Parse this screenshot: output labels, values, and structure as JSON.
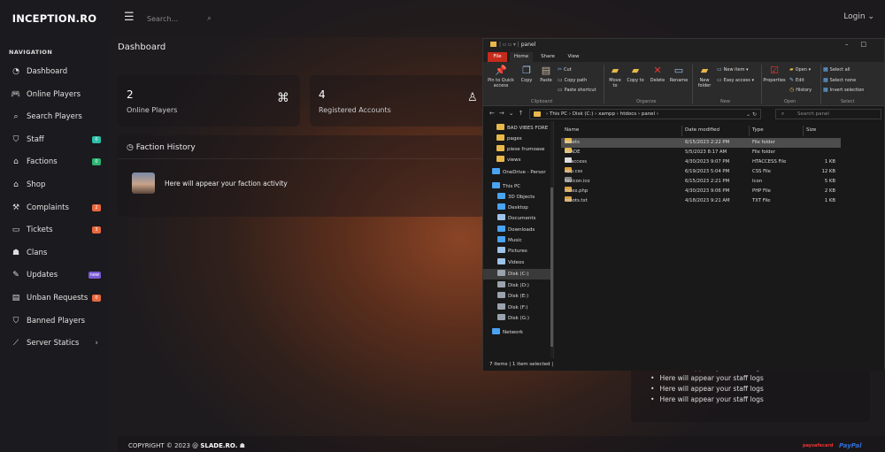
{
  "site": {
    "brand": "INCEPTION.RO",
    "login_label": "Login ⌄"
  },
  "search": {
    "placeholder": "Search..."
  },
  "sidebar": {
    "section_title": "NAVIGATION",
    "items": [
      {
        "label": "Dashboard",
        "icon": "dashboard-icon",
        "glyph": "◔"
      },
      {
        "label": "Online Players",
        "icon": "gamepad-icon",
        "glyph": "🎮"
      },
      {
        "label": "Search Players",
        "icon": "search-icon",
        "glyph": "⌕"
      },
      {
        "label": "Staff",
        "icon": "shield-icon",
        "glyph": "⛉",
        "badge": "0",
        "badge_color": "#2bbfa8"
      },
      {
        "label": "Factions",
        "icon": "bank-icon",
        "glyph": "⌂",
        "badge": "0",
        "badge_color": "#2bb673"
      },
      {
        "label": "Shop",
        "icon": "shop-icon",
        "glyph": "⌂"
      },
      {
        "label": "Complaints",
        "icon": "hammer-icon",
        "glyph": "⚒",
        "badge": "2",
        "badge_color": "#e9683e"
      },
      {
        "label": "Tickets",
        "icon": "ticket-icon",
        "glyph": "▭",
        "badge": "3",
        "badge_color": "#e9683e"
      },
      {
        "label": "Clans",
        "icon": "clans-icon",
        "glyph": "☗"
      },
      {
        "label": "Updates",
        "icon": "updates-icon",
        "glyph": "✎",
        "badge": "new",
        "badge_color": "#7a5ad6"
      },
      {
        "label": "Unban Requests",
        "icon": "document-icon",
        "glyph": "▤",
        "badge": "0",
        "badge_color": "#e9683e"
      },
      {
        "label": "Banned Players",
        "icon": "ban-shield-icon",
        "glyph": "⛉"
      },
      {
        "label": "Server Statics",
        "icon": "chart-icon",
        "glyph": "⟋",
        "chevron": "›"
      }
    ]
  },
  "dashboard": {
    "title": "Dashboard",
    "stats": [
      {
        "value": "2",
        "label": "Online Players"
      },
      {
        "value": "4",
        "label": "Registered Accounts"
      }
    ],
    "faction_history": {
      "title": "Faction History",
      "message": "Here will appear your faction activity"
    },
    "staff_logs": [
      "Here will appear your staff logs",
      "Here will appear your staff logs",
      "Here will appear your staff logs",
      "Here will appear your staff logs"
    ]
  },
  "footer": {
    "copyright_prefix": "COPYRIGHT © 2023 @ ",
    "copyright_site": "SLADE.RO.",
    "payment1": "paysafecard",
    "payment2": "PayPal"
  },
  "explorer": {
    "title": "panel",
    "tabs": [
      "File",
      "Home",
      "Share",
      "View"
    ],
    "ribbon": {
      "pin": "Pin to Quick access",
      "copy": "Copy",
      "paste": "Paste",
      "cut": "Cut",
      "copy_path": "Copy path",
      "paste_shortcut": "Paste shortcut",
      "move_to": "Move to",
      "copy_to": "Copy to",
      "delete": "Delete",
      "rename": "Rename",
      "new_folder": "New folder",
      "new_item": "New item",
      "easy_access": "Easy access",
      "properties": "Properties",
      "open": "Open",
      "edit": "Edit",
      "history": "History",
      "select_all": "Select all",
      "select_none": "Select none",
      "invert_selection": "Invert selection",
      "groups": [
        "Clipboard",
        "Organize",
        "New",
        "Open",
        "Select"
      ]
    },
    "address": [
      "This PC",
      "Disk (C:)",
      "xampp",
      "htdocs",
      "panel"
    ],
    "search_placeholder": "Search panel",
    "nav": [
      {
        "label": "BAD VIBES FORE",
        "type": "folder"
      },
      {
        "label": "pages",
        "type": "folder"
      },
      {
        "label": "piese frumoase",
        "type": "folder"
      },
      {
        "label": "views",
        "type": "folder"
      },
      {
        "label": "OneDrive - Persor",
        "type": "cloud"
      },
      {
        "label": "This PC",
        "type": "pc"
      },
      {
        "label": "3D Objects",
        "type": "obj"
      },
      {
        "label": "Desktop",
        "type": "desk"
      },
      {
        "label": "Documents",
        "type": "docs"
      },
      {
        "label": "Downloads",
        "type": "down"
      },
      {
        "label": "Music",
        "type": "music"
      },
      {
        "label": "Pictures",
        "type": "pics"
      },
      {
        "label": "Videos",
        "type": "video"
      },
      {
        "label": "Disk (C:)",
        "type": "disk",
        "selected": true
      },
      {
        "label": "Disk (D:)",
        "type": "disk"
      },
      {
        "label": "Disk (E:)",
        "type": "disk"
      },
      {
        "label": "Disk (F:)",
        "type": "disk"
      },
      {
        "label": "Disk (G:)",
        "type": "disk"
      },
      {
        "label": "Network",
        "type": "net"
      }
    ],
    "columns": [
      "Name",
      "Date modified",
      "Type",
      "Size"
    ],
    "files": [
      {
        "name": "assets",
        "date": "6/15/2023 2:22 PM",
        "type": "File folder",
        "size": "",
        "kind": "folder",
        "selected": true
      },
      {
        "name": "SLADE",
        "date": "5/5/2023 8:17 AM",
        "type": "File folder",
        "size": "",
        "kind": "folder"
      },
      {
        "name": ".htaccess",
        "date": "4/30/2023 9:07 PM",
        "type": "HTACCESS File",
        "size": "1 KB",
        "kind": "file"
      },
      {
        "name": "app.css",
        "date": "6/19/2023 5:04 PM",
        "type": "CSS File",
        "size": "12 KB",
        "kind": "code"
      },
      {
        "name": "favicon.ico",
        "date": "6/15/2023 2:21 PM",
        "type": "Icon",
        "size": "5 KB",
        "kind": "ico"
      },
      {
        "name": "index.php",
        "date": "4/30/2023 9:06 PM",
        "type": "PHP File",
        "size": "2 KB",
        "kind": "code"
      },
      {
        "name": "robots.txt",
        "date": "4/18/2023 9:21 AM",
        "type": "TXT File",
        "size": "1 KB",
        "kind": "code"
      }
    ],
    "status": "7 items  |  1 item selected  |"
  }
}
